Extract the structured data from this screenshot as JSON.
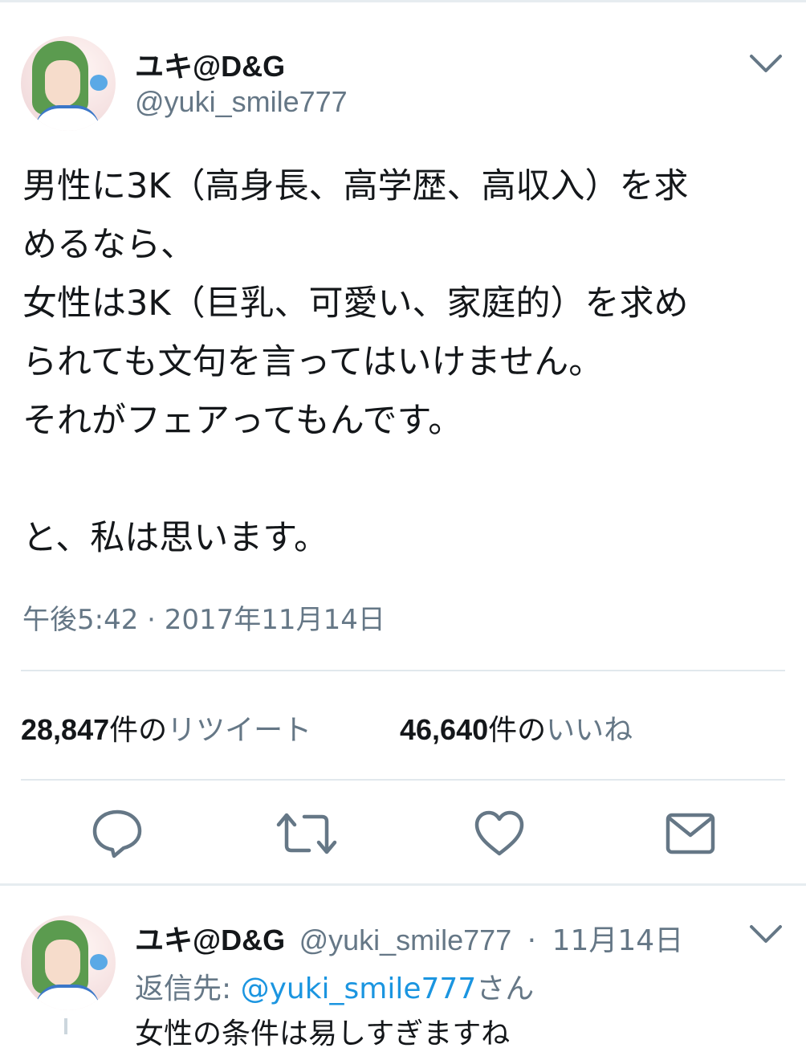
{
  "tweet": {
    "display_name": "ユキ@D&G",
    "handle": "@yuki_smile777",
    "text_lines": [
      "男性に3K（高身長、高学歴、高収入）を求",
      "めるなら、",
      "女性は3K（巨乳、可愛い、家庭的）を求め",
      "られても文句を言ってはいけません。",
      "それがフェアってもんです。",
      "",
      "と、私は思います。"
    ],
    "timestamp": "午後5:42 · 2017年11月14日",
    "retweets": {
      "count": "28,847",
      "unit": "件の",
      "label": "リツイート"
    },
    "likes": {
      "count": "46,640",
      "unit": "件の",
      "label": "いいね"
    },
    "actions": [
      "reply-icon",
      "retweet-icon",
      "like-icon",
      "message-icon"
    ]
  },
  "reply": {
    "display_name": "ユキ@D&G",
    "handle": "@yuki_smile777",
    "separator": "·",
    "date": "11月14日",
    "reply_to_prefix": "返信先: ",
    "reply_to_mention": "@yuki_smile777",
    "reply_to_suffix": "さん",
    "text": "女性の条件は易しすぎますね"
  },
  "colors": {
    "text_primary": "#14171a",
    "text_secondary": "#657786",
    "link": "#1b95e0",
    "divider": "#e1e8ed"
  }
}
